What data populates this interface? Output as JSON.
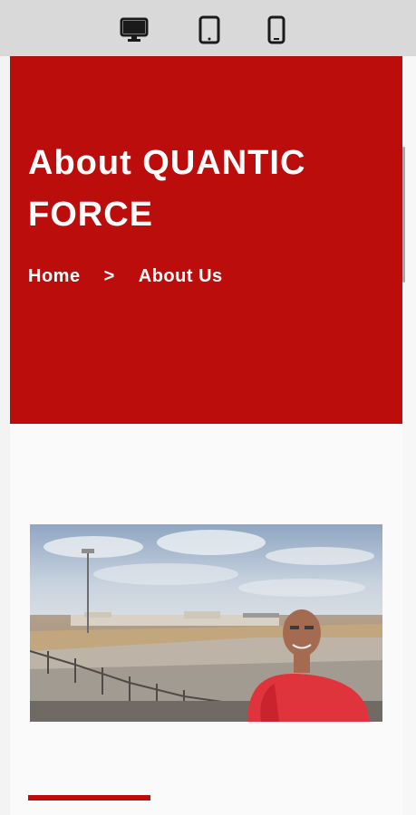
{
  "toolbar": {
    "devices": [
      {
        "icon": "desktop-icon",
        "label": "Desktop"
      },
      {
        "icon": "tablet-icon",
        "label": "Tablet"
      },
      {
        "icon": "mobile-icon",
        "label": "Mobile"
      }
    ]
  },
  "hero": {
    "title": "About QUANTIC FORCE",
    "background_color": "#bc0d0d"
  },
  "breadcrumb": {
    "home": "Home",
    "separator": ">",
    "current": "About Us"
  },
  "image": {
    "description_icon": "photo-icon"
  },
  "accent_color": "#bc0d0d"
}
